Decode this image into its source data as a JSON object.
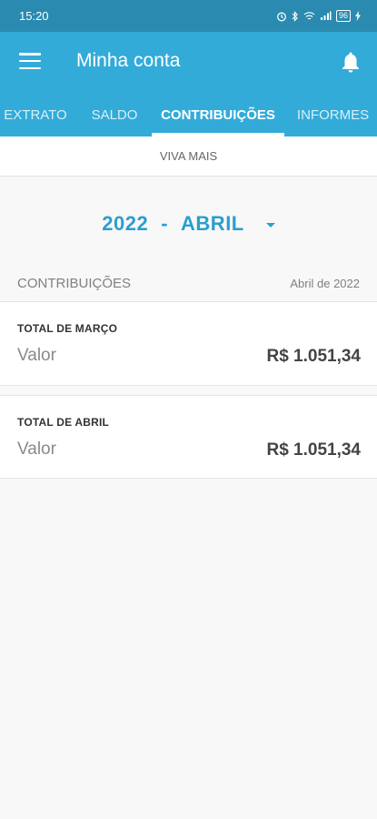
{
  "status_bar": {
    "time": "15:20",
    "battery": "96"
  },
  "app_bar": {
    "title": "Minha conta"
  },
  "tabs": [
    {
      "label": "EXTRATO"
    },
    {
      "label": "SALDO"
    },
    {
      "label": "CONTRIBUIÇÕES",
      "active": true
    },
    {
      "label": "INFORMES"
    }
  ],
  "subtab": {
    "label": "VIVA MAIS"
  },
  "period": {
    "year": "2022",
    "separator": "-",
    "month": "ABRIL"
  },
  "section": {
    "title": "CONTRIBUIÇÕES",
    "date": "Abril de 2022"
  },
  "cards": [
    {
      "label": "TOTAL DE MARÇO",
      "key": "Valor",
      "value": "R$ 1.051,34"
    },
    {
      "label": "TOTAL DE ABRIL",
      "key": "Valor",
      "value": "R$ 1.051,34"
    }
  ],
  "colors": {
    "primary": "#33abd8",
    "status_bar": "#2a8ab0",
    "accent_text": "#2a9fcf"
  }
}
